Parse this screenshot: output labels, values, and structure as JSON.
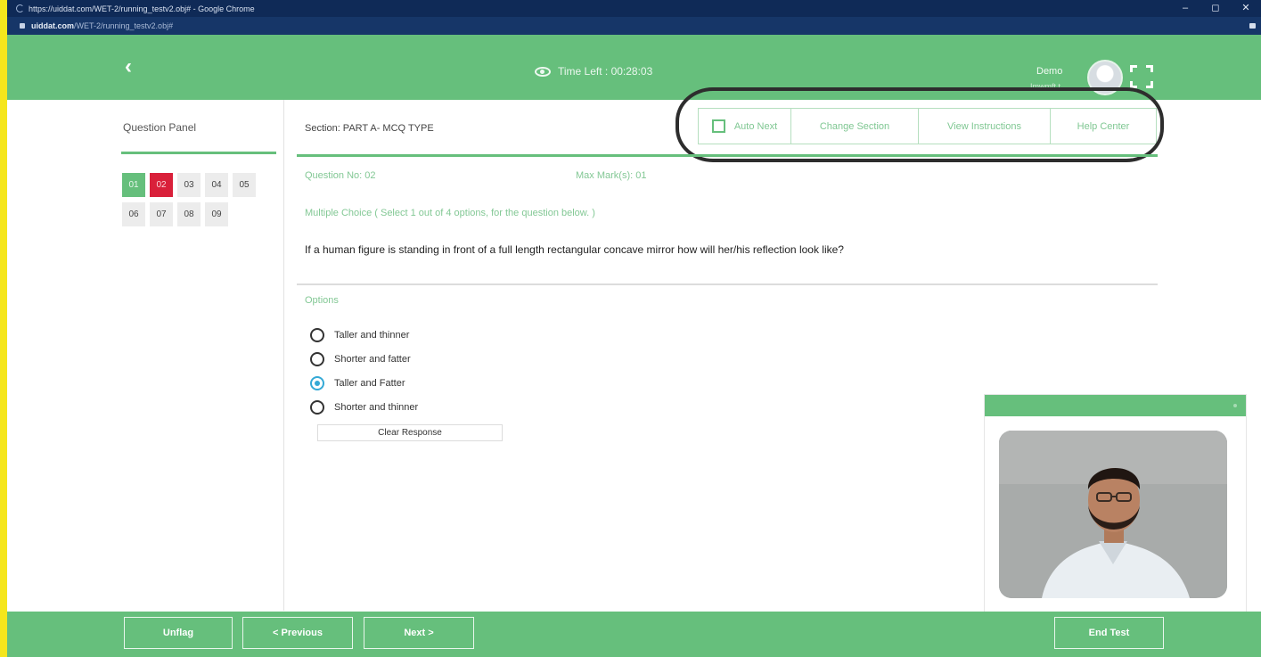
{
  "browser": {
    "title": "https://uiddat.com/WET-2/running_testv2.obj# - Google Chrome",
    "url_host": "uiddat.com",
    "url_path": "/WET-2/running_testv2.obj#",
    "controls": {
      "minimize": "–",
      "restore": "◻",
      "close": "✕"
    }
  },
  "header": {
    "back_icon": "‹",
    "timer_label": "Time Left : 00:28:03",
    "user_name": "Demo",
    "user_sub": "Imwmft t"
  },
  "question_panel": {
    "title": "Question Panel",
    "questions": [
      {
        "number": "01",
        "status": "answered"
      },
      {
        "number": "02",
        "status": "current"
      },
      {
        "number": "03",
        "status": "not-visited"
      },
      {
        "number": "04",
        "status": "not-visited"
      },
      {
        "number": "05",
        "status": "not-visited"
      },
      {
        "number": "06",
        "status": "not-visited"
      },
      {
        "number": "07",
        "status": "not-visited"
      },
      {
        "number": "08",
        "status": "not-visited"
      },
      {
        "number": "09",
        "status": "not-visited"
      }
    ]
  },
  "section": {
    "label": "Section: PART A- MCQ TYPE"
  },
  "toolbar": {
    "auto_next": "Auto Next",
    "change_section": "Change Section",
    "view_instructions": "View Instructions",
    "help_center": "Help Center"
  },
  "question": {
    "number_label": "Question No: 02",
    "max_marks_label": "Max Mark(s): 01",
    "type_label": "Multiple Choice ( Select 1 out of 4 options, for the question below. )",
    "text": "If a human figure is standing in front of a full length rectangular concave mirror how will her/his reflection look like?"
  },
  "options": {
    "label": "Options",
    "items": [
      {
        "text": "Taller and thinner",
        "selected": false
      },
      {
        "text": "Shorter and fatter",
        "selected": false
      },
      {
        "text": "Taller and Fatter",
        "selected": true
      },
      {
        "text": "Shorter and thinner",
        "selected": false
      }
    ],
    "clear_label": "Clear Response"
  },
  "footer": {
    "unflag": "Unflag",
    "previous": "< Previous",
    "next": "Next >",
    "end_test": "End Test"
  },
  "colors": {
    "primary_green": "#66bf7c",
    "current_red": "#d9203a",
    "selected_blue": "#34a9d6",
    "browser_navy": "#0f2a57"
  }
}
